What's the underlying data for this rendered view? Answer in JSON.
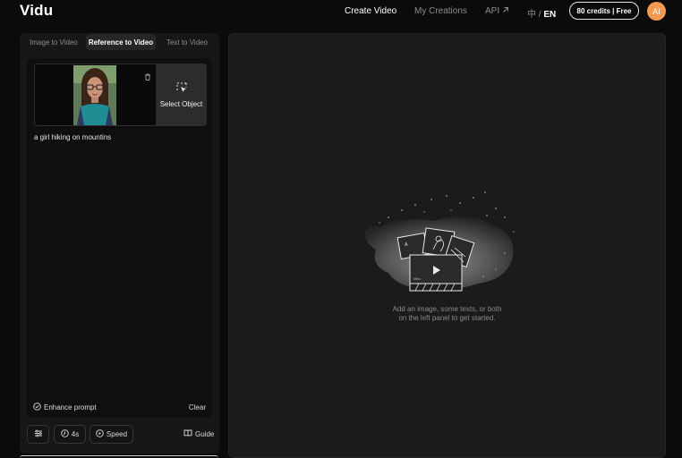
{
  "header": {
    "logo": "Vidu",
    "nav": {
      "create_video": "Create Video",
      "my_creations": "My Creations",
      "api": "API",
      "lang_zh": "中 / ",
      "lang_en": "EN"
    },
    "credits": "80 credits | Free",
    "avatar": "AI"
  },
  "left_panel": {
    "tabs": [
      "Image to Video",
      "Reference to Video",
      "Text to Video"
    ],
    "active_tab": "Reference to Video",
    "select_object": "Select Object",
    "prompt": "a girl hiking on mountins",
    "enhance_prompt": "Enhance prompt",
    "clear": "Clear",
    "controls": {
      "duration": "4s",
      "speed": "Speed",
      "guide": "Guide"
    }
  },
  "right_panel": {
    "hint_line1": "Add an image, some texts, or both",
    "hint_line2": "on the left panel to get started."
  },
  "icons": {
    "api_arrow": "arrow-up-right-icon",
    "trash": "trash-icon",
    "select_object": "select-object-icon",
    "enhance": "check-circle-icon",
    "settings": "sliders-icon",
    "duration": "clock-icon",
    "speed": "speed-icon",
    "guide": "book-icon"
  },
  "colors": {
    "background": "#0b0b0b",
    "panel": "#171717",
    "avatar": "#f39a4e",
    "text_primary": "#ffffff",
    "text_muted": "#8b8b8b"
  }
}
